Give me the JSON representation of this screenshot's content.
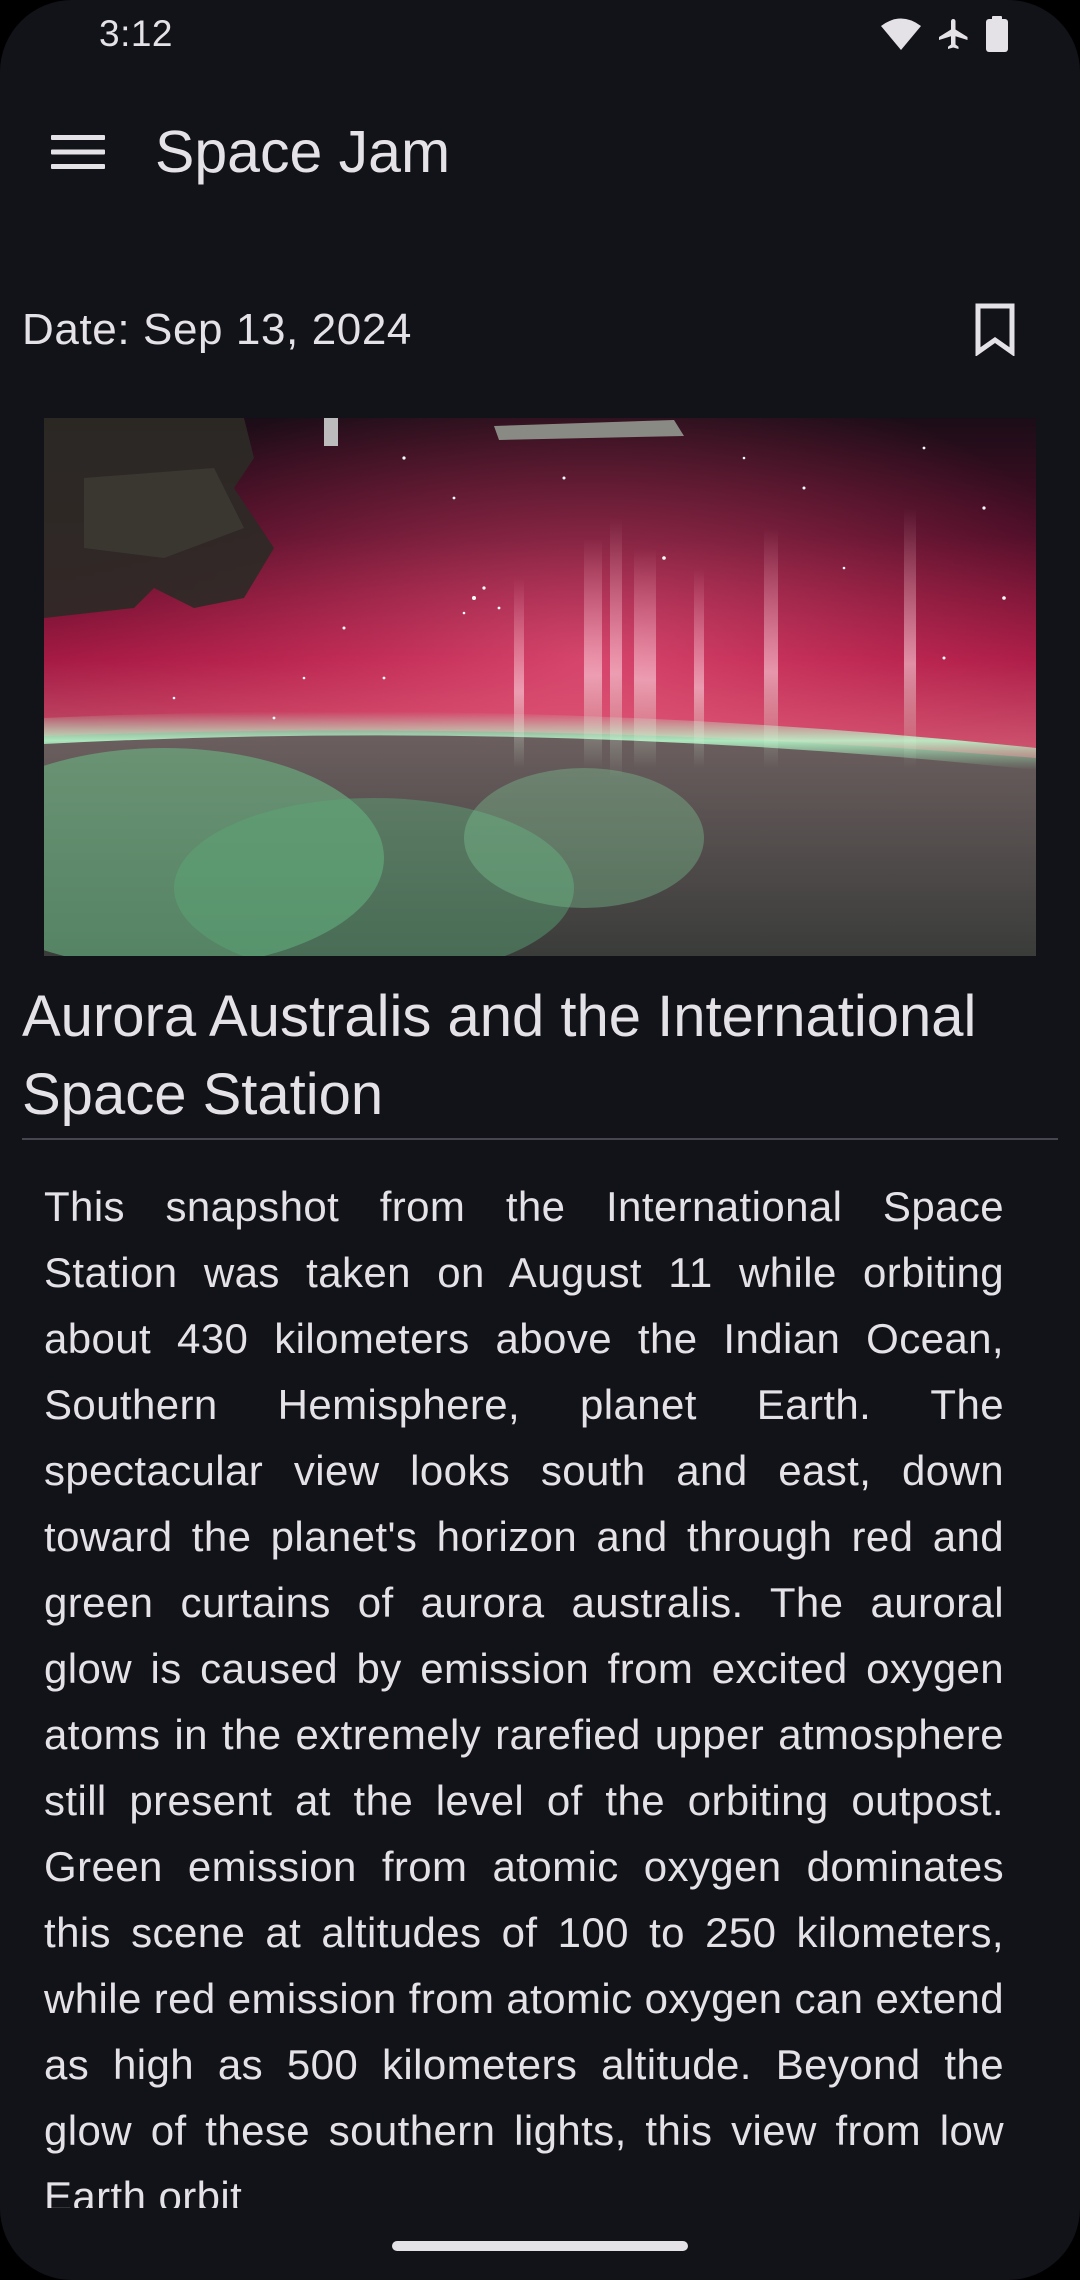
{
  "status_bar": {
    "time": "3:12",
    "icons": [
      "wifi-icon",
      "airplane-mode-icon",
      "battery-icon"
    ]
  },
  "app_bar": {
    "title": "Space Jam",
    "menu_icon": "menu-icon"
  },
  "apod": {
    "date_label": "Date: Sep 13, 2024",
    "bookmark_icon": "bookmark-outline-icon",
    "title": "Aurora Australis and the International Space Station",
    "description": "This snapshot from the International Space Station was taken on August 11 while orbiting about 430 kilometers above the Indian Ocean, Southern Hemisphere, planet Earth. The spectacular view looks south and east, down toward the planet's horizon and through red and green curtains of aurora australis. The auroral glow is caused by emission from excited oxygen atoms in the extremely rarefied upper atmosphere still present at the level of the orbiting outpost. Green emission from atomic oxygen dominates this scene at altitudes of 100 to 250 kilometers, while red emission from atomic oxygen can extend as high as 500 kilometers altitude. Beyond the glow of these southern lights, this view from low Earth orbit"
  },
  "colors": {
    "background": "#121318",
    "on_surface": "#e4e2e6",
    "divider": "#45464f",
    "aurora_red": "#b3163f",
    "aurora_green": "#7fe3a0"
  }
}
